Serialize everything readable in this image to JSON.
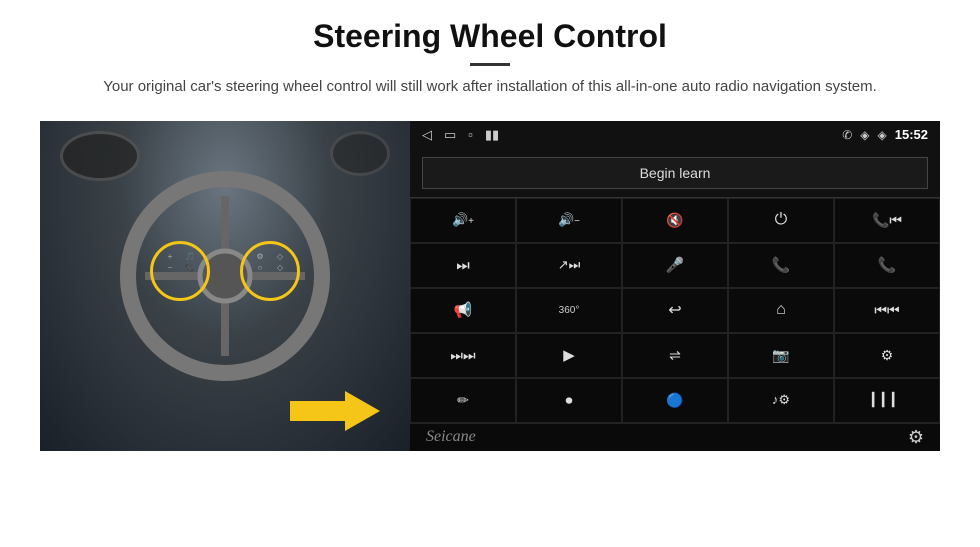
{
  "header": {
    "title": "Steering Wheel Control",
    "subtitle": "Your original car's steering wheel control will still work after installation of this all-in-one auto radio navigation system."
  },
  "status_bar": {
    "back_icon": "◁",
    "home_icon": "▭",
    "recent_icon": "▫",
    "signal_icon": "▮▮",
    "location_icon": "◈",
    "wifi_icon": "◈",
    "time": "15:52",
    "phone_icon": "✆"
  },
  "begin_learn": {
    "label": "Begin learn"
  },
  "controls": [
    {
      "icon": "🔊+",
      "name": "vol-up"
    },
    {
      "icon": "🔊−",
      "name": "vol-down"
    },
    {
      "icon": "🔇",
      "name": "mute"
    },
    {
      "icon": "⏻",
      "name": "power"
    },
    {
      "icon": "⏮",
      "name": "prev-track"
    },
    {
      "icon": "⏭",
      "name": "next"
    },
    {
      "icon": "⤮⏭",
      "name": "shuffle-next"
    },
    {
      "icon": "🎤",
      "name": "mic"
    },
    {
      "icon": "📞",
      "name": "call"
    },
    {
      "icon": "📞↩",
      "name": "end-call"
    },
    {
      "icon": "📢",
      "name": "speaker"
    },
    {
      "icon": "360°",
      "name": "360-view"
    },
    {
      "icon": "↩",
      "name": "back"
    },
    {
      "icon": "⌂",
      "name": "home"
    },
    {
      "icon": "⏮⏮",
      "name": "prev-chapter"
    },
    {
      "icon": "⏭⏭",
      "name": "fast-forward"
    },
    {
      "icon": "▶",
      "name": "navigate"
    },
    {
      "icon": "⇌",
      "name": "switch"
    },
    {
      "icon": "📷",
      "name": "camera"
    },
    {
      "icon": "⚙",
      "name": "equalizer"
    },
    {
      "icon": "✏",
      "name": "edit"
    },
    {
      "icon": "⏺",
      "name": "record"
    },
    {
      "icon": "🔵",
      "name": "bluetooth"
    },
    {
      "icon": "♪⚙",
      "name": "music-settings"
    },
    {
      "icon": "▎▎▎",
      "name": "spectrum"
    }
  ],
  "bottom": {
    "logo": "Seicane",
    "settings_icon": "⚙"
  },
  "colors": {
    "accent": "#f5c518",
    "bg_dark": "#000000",
    "bg_panel": "#0a0a0a",
    "text_light": "#dddddd"
  }
}
